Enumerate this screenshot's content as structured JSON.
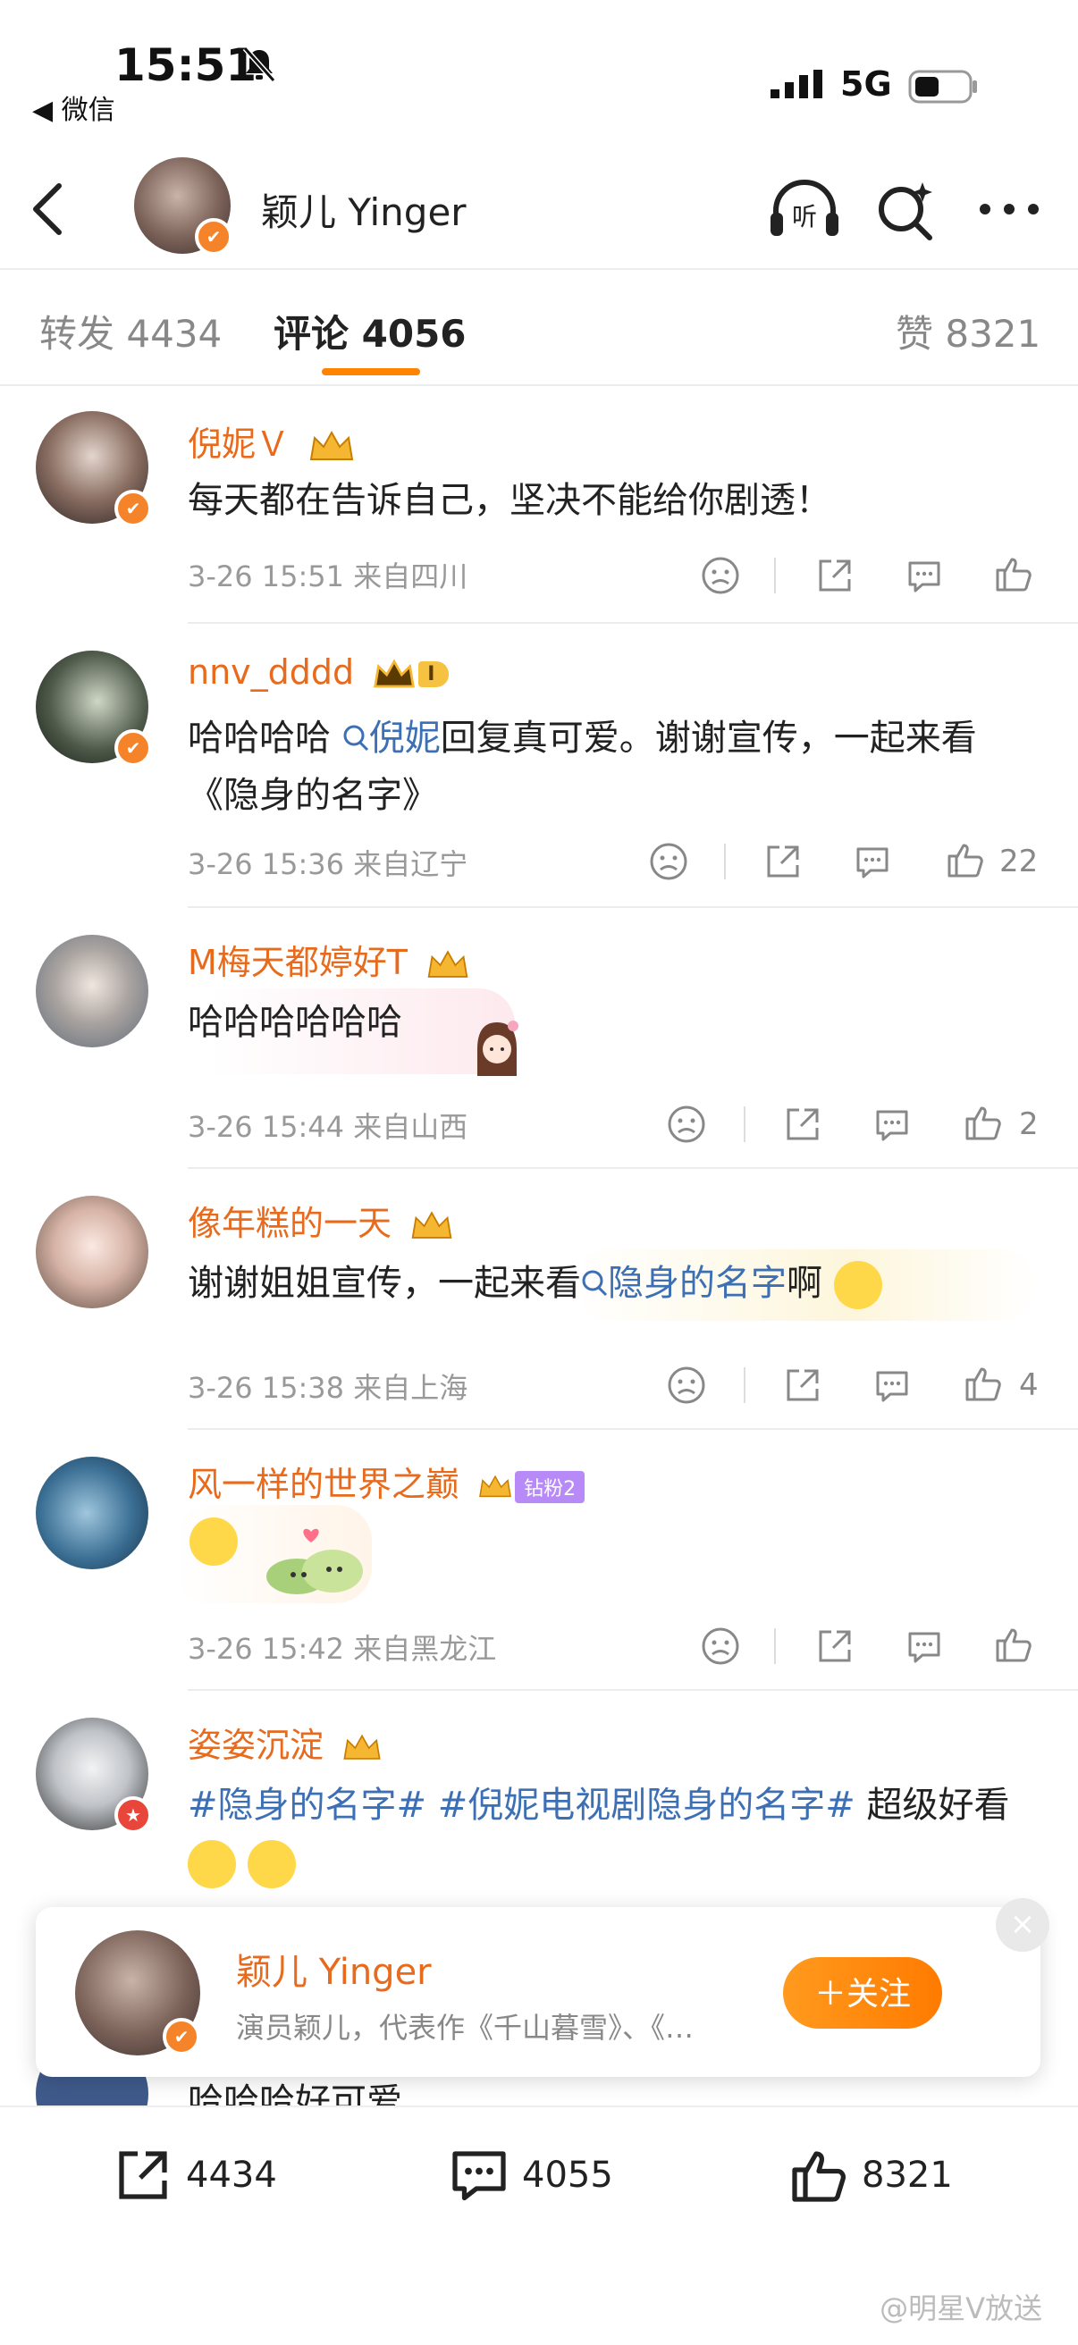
{
  "status_bar": {
    "time": "15:51",
    "back_app": "◀ 微信",
    "network": "5G"
  },
  "header": {
    "user_name": "颖儿 Yinger",
    "verified_glyph": "✔"
  },
  "tabs": [
    {
      "label": "转发 4434"
    },
    {
      "label": "评论 4056"
    },
    {
      "label": "赞 8321"
    }
  ],
  "comments": [
    {
      "name": "倪妮Ｖ",
      "text": "每天都在告诉自己，坚决不能给你剧透！",
      "meta": "3-26 15:51  来自四川",
      "likes": ""
    },
    {
      "name": "nnv_dddd",
      "level": "I",
      "text_before": "哈哈哈哈",
      "link": "倪妮",
      "text_after": "回复真可爱。谢谢宣传，一起来看《隐身的名字》",
      "meta": "3-26 15:36  来自辽宁",
      "likes": "22"
    },
    {
      "name": "M梅天都婷好T",
      "text": "哈哈哈哈哈哈",
      "meta": "3-26 15:44  来自山西",
      "likes": "2"
    },
    {
      "name": "像年糕的一天",
      "text_before": "谢谢姐姐宣传，一起来看",
      "link": "隐身的名字",
      "text_after": "啊",
      "meta": "3-26 15:38  来自上海",
      "likes": "4"
    },
    {
      "name": "风一样的世界之巅",
      "fan_badge": "钻粉2",
      "meta": "3-26 15:42  来自黑龙江",
      "likes": ""
    },
    {
      "name": "姿姿沉淀",
      "topic1": "#隐身的名字#",
      "topic2": "#倪妮电视剧隐身的名字#",
      "text_after": " 超级好看"
    },
    {
      "text": "哈哈哈好可爱"
    }
  ],
  "follow_card": {
    "name": "颖儿 Yinger",
    "desc": "演员颖儿，代表作《千山暮雪》、《…",
    "follow_label": "＋关注",
    "close_glyph": "×"
  },
  "bottom_bar": {
    "repost_count": "4434",
    "comment_count": "4055",
    "like_count": "8321"
  },
  "watermark": "@明星V放送",
  "colors": {
    "accent": "#ff8200",
    "name": "#e86a1c",
    "link": "#3c6fb4"
  }
}
